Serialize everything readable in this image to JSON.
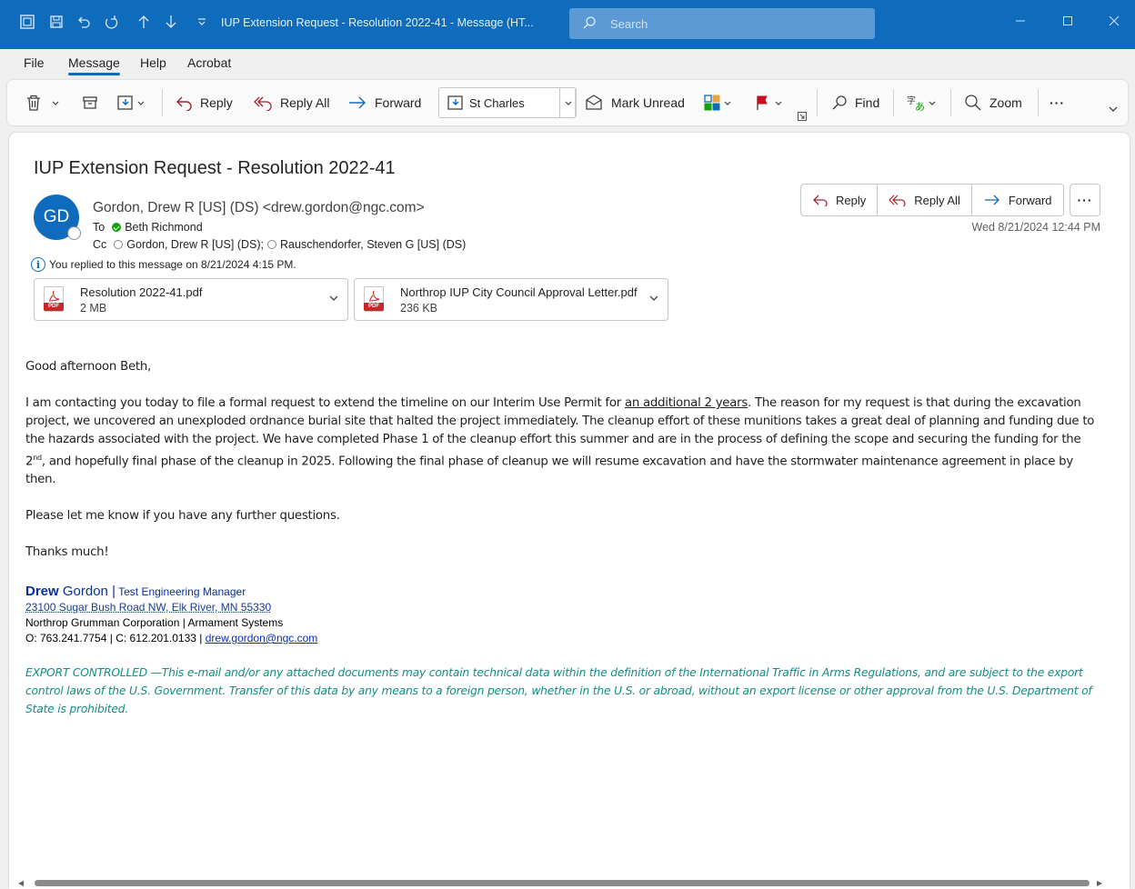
{
  "window": {
    "title": "IUP Extension Request - Resolution 2022-41  -  Message (HT...",
    "search_placeholder": "Search"
  },
  "menu": {
    "items": [
      "File",
      "Message",
      "Help",
      "Acrobat"
    ],
    "active": "Message"
  },
  "ribbon": {
    "reply": "Reply",
    "reply_all": "Reply All",
    "forward": "Forward",
    "move_to": "St Charles",
    "mark_unread": "Mark Unread",
    "find": "Find",
    "zoom": "Zoom",
    "more": "···"
  },
  "message": {
    "subject": "IUP Extension Request - Resolution 2022-41",
    "avatar_initials": "GD",
    "sender": "Gordon, Drew R [US] (DS) <drew.gordon@ngc.com>",
    "to_label": "To",
    "to": "Beth Richmond",
    "cc_label": "Cc",
    "cc": [
      "Gordon, Drew R [US] (DS);",
      "Rauschendorfer, Steven G [US] (DS)"
    ],
    "info": "You replied to this message on 8/21/2024 4:15 PM.",
    "date": "Wed 8/21/2024 12:44 PM",
    "actions": {
      "reply": "Reply",
      "reply_all": "Reply All",
      "forward": "Forward",
      "more": "···"
    },
    "attachments": [
      {
        "name": "Resolution 2022-41.pdf",
        "size": "2 MB",
        "type_badge": "PDF"
      },
      {
        "name": "Northrop IUP City Council Approval Letter.pdf",
        "size": "236 KB",
        "type_badge": "PDF"
      }
    ]
  },
  "body": {
    "greeting": "Good afternoon Beth,",
    "p1_a": "I am contacting you today to file a formal request to extend the timeline on our Interim Use Permit for ",
    "p1_u": "an additional 2 years",
    "p1_b": ".  The reason for my request is that during the excavation project, we uncovered an unexploded ordnance burial site that halted the project immediately.  The cleanup effort of these munitions takes a great deal of planning and funding due to the hazards associated with the project.  We have completed Phase 1 of the cleanup effort this summer and are in the process of defining the scope and securing the funding for the 2",
    "p1_sup": "nd",
    "p1_c": ", and hopefully final phase of the cleanup in 2025.  Following the final phase of cleanup we will resume excavation and have the stormwater maintenance agreement in place by then.",
    "p2": "Please let me know if you have any further questions.",
    "p3": "Thanks much!"
  },
  "signature": {
    "first": "Drew",
    "last": "Gordon",
    "sep": "|",
    "title": "Test Engineering Manager",
    "address": "23100 Sugar Bush Road NW, Elk River, MN 55330",
    "company": "Northrop Grumman Corporation | Armament Systems",
    "phones": "O: 763.241.7754  |  C: 612.201.0133  |  ",
    "email": "drew.gordon@ngc.com"
  },
  "export_notice": "EXPORT CONTROLLED —This e-mail and/or any attached documents may contain technical data within the definition of the International Traffic in Arms Regulations, and are subject to the export control laws of the U.S. Government. Transfer of this data by any means to a foreign person, whether in the U.S. or abroad, without an export license or other approval from the U.S. Department of State is prohibited.",
  "colors": {
    "accent": "#0f6cbd",
    "signature_blue": "#0a2f9e",
    "export_teal": "#108f84",
    "flag_red": "#c50f1f"
  }
}
